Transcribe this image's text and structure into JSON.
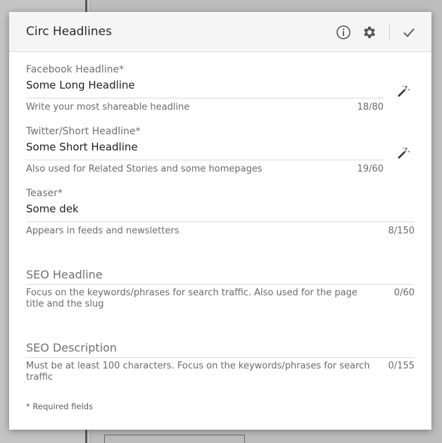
{
  "dialog": {
    "title": "Circ Headlines",
    "icons": {
      "info": "info-icon",
      "settings": "gear-icon",
      "confirm": "checkmark-icon",
      "generate": "magic-wand-icon"
    }
  },
  "fields": {
    "facebook": {
      "label": "Facebook Headline*",
      "value": "Some Long Headline",
      "help": "Write your most shareable headline",
      "count": "18/80"
    },
    "twitter": {
      "label": "Twitter/Short Headline*",
      "value": "Some Short Headline",
      "help": "Also used for Related Stories and some homepages",
      "count": "19/60"
    },
    "teaser": {
      "label": "Teaser*",
      "value": "Some dek",
      "help": "Appears in feeds and newsletters",
      "count": "8/150"
    },
    "seo_headline": {
      "label": "SEO Headline",
      "value": "",
      "help": "Focus on the keywords/phrases for search traffic. Also used for the page title and the slug",
      "count": "0/60"
    },
    "seo_description": {
      "label": "SEO Description",
      "value": "",
      "help": "Must be at least 100 characters. Focus on the keywords/phrases for search traffic",
      "count": "0/155"
    }
  },
  "footer": {
    "required_note": "* Required fields"
  },
  "colors": {
    "header_bg": "#f5f5f5",
    "text": "#1f1f1f",
    "muted": "#6b6b6b",
    "divider": "#d9d9d9"
  }
}
